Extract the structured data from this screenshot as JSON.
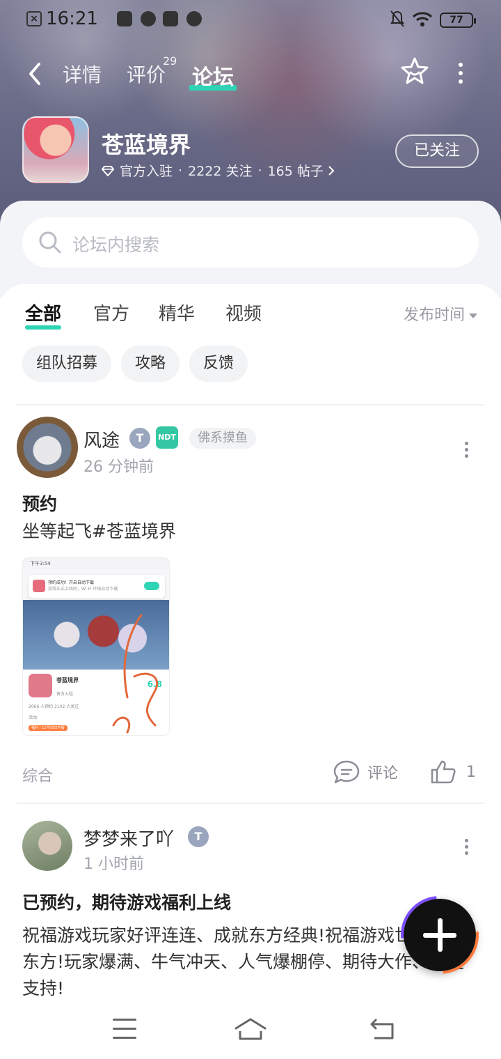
{
  "status_bar": {
    "time": "16:21",
    "battery": "77"
  },
  "nav": {
    "tabs": [
      {
        "label": "详情"
      },
      {
        "label": "评价",
        "badge": "29"
      },
      {
        "label": "论坛"
      }
    ]
  },
  "app": {
    "name": "苍蓝境界",
    "official": "官方入驻",
    "followers": "2222 关注",
    "posts": "165 帖子",
    "follow_button": "已关注"
  },
  "search": {
    "placeholder": "论坛内搜索"
  },
  "filters": {
    "tabs": [
      "全部",
      "官方",
      "精华",
      "视频"
    ],
    "sort": "发布时间",
    "chips": [
      "组队招募",
      "攻略",
      "反馈"
    ]
  },
  "posts": [
    {
      "user": "风途",
      "badge_ndt": "NDT",
      "tag": "佛系摸鱼",
      "time": "26 分钟前",
      "title": "预约",
      "body": "坐等起飞#苍蓝境界",
      "category": "综合",
      "comment_label": "评论",
      "likes": "1",
      "screenshot": {
        "status_time": "下午3:54",
        "toast_title": "预约成功！开启自动下载",
        "toast_sub": "游戏正式上线时，Wi-Fi 环境自动下载",
        "app_name": "苍蓝境界",
        "score": "6.8",
        "official": "官方入驻",
        "stats": "2066 人预约   2102 人关注",
        "activity": "活动",
        "banner": "福利 | 12月05日开服"
      }
    },
    {
      "user": "梦梦来了吖",
      "time": "1 小时前",
      "title": "已预约，期待游戏福利上线",
      "body": "祝福游戏玩家好评连连、成就东方经典!祝福游戏世界!鼎耀东方!玩家爆满、牛气冲天、人气爆棚停、期待大作、永远支持!"
    }
  ]
}
